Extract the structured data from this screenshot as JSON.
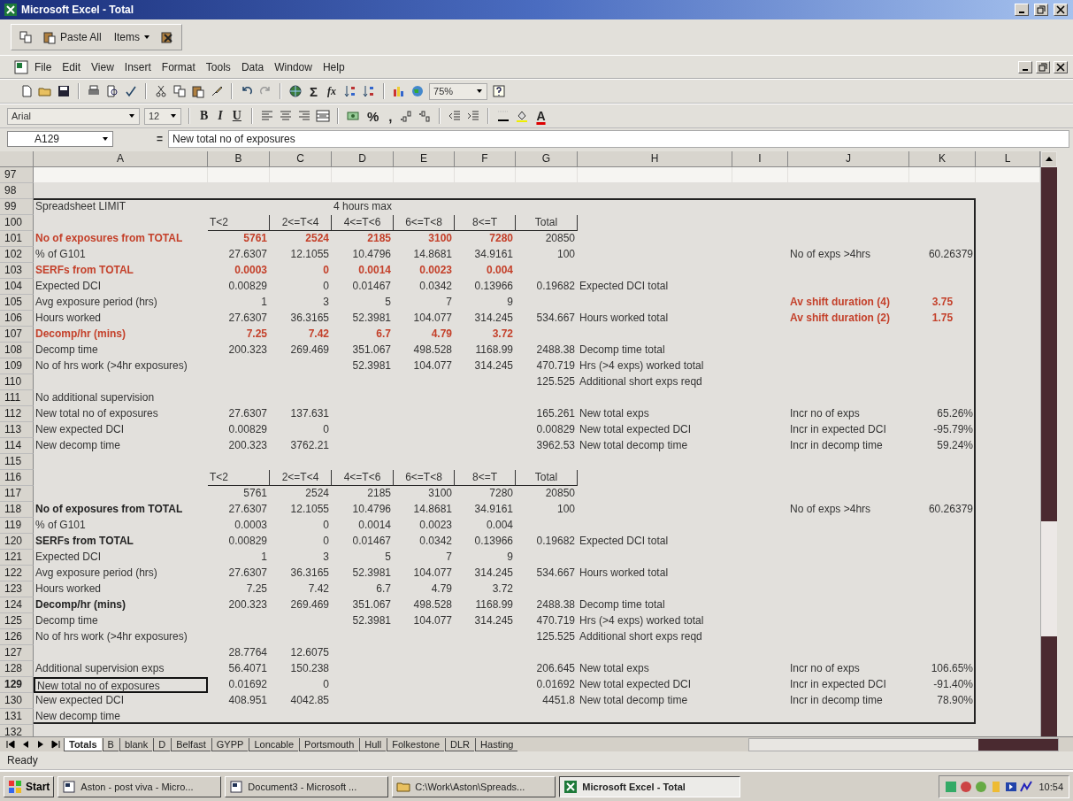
{
  "window": {
    "title": "Microsoft Excel - Total"
  },
  "clipboard_toolbar": {
    "paste_all": "Paste All",
    "items": "Items"
  },
  "menu": [
    "File",
    "Edit",
    "View",
    "Insert",
    "Format",
    "Tools",
    "Data",
    "Window",
    "Help"
  ],
  "standard_toolbar": {
    "sum": "Σ",
    "function": "fx",
    "zoom": "75%"
  },
  "formatting_toolbar": {
    "font": "Arial",
    "size": "12",
    "bold": "B",
    "italic": "I",
    "underline": "U",
    "percent": "%",
    "comma": ",",
    "font_color": "A"
  },
  "formula_bar": {
    "name_box": "A129",
    "equals": "=",
    "content": "New total no of exposures"
  },
  "columns": [
    "A",
    "B",
    "C",
    "D",
    "E",
    "F",
    "G",
    "H",
    "I",
    "J",
    "K",
    "L"
  ],
  "rows": [
    {
      "num": "97",
      "selected": false,
      "cells": {}
    },
    {
      "num": "98",
      "selected": false,
      "cells": {}
    },
    {
      "num": "99",
      "kind": "caption",
      "selected": false,
      "cells": {
        "A": "Spreadsheet LIMIT",
        "D": "4 hours max"
      }
    },
    {
      "num": "100",
      "kind": "header",
      "selected": false,
      "cells": {
        "B": "T<2",
        "C": "2<=T<4",
        "D": "4<=T<6",
        "E": "6<=T<8",
        "F": "8<=T",
        "G": "Total"
      }
    },
    {
      "num": "101",
      "kind": "highlighted",
      "selected": false,
      "cells": {
        "A": "No of exposures from TOTAL",
        "B": "5761",
        "C": "2524",
        "D": "2185",
        "E": "3100",
        "F": "7280",
        "G": "20850"
      }
    },
    {
      "num": "102",
      "kind": "plain",
      "selected": false,
      "cells": {
        "A": "% of G101",
        "B": "27.6307",
        "C": "12.1055",
        "D": "10.4796",
        "E": "14.8681",
        "F": "34.9161",
        "G": "100",
        "J": "No of exps >4hrs",
        "K": "60.26379"
      }
    },
    {
      "num": "103",
      "kind": "highlighted",
      "selected": false,
      "cells": {
        "A": "SERFs from TOTAL",
        "B": "0.0003",
        "C": "0",
        "D": "0.0014",
        "E": "0.0023",
        "F": "0.004"
      }
    },
    {
      "num": "104",
      "kind": "plain",
      "selected": false,
      "cells": {
        "A": "Expected DCI",
        "B": "0.00829",
        "C": "0",
        "D": "0.01467",
        "E": "0.0342",
        "F": "0.13966",
        "G": "0.19682",
        "H": "Expected DCI total"
      }
    },
    {
      "num": "105",
      "kind": "shift",
      "selected": false,
      "cells": {
        "A": "Avg exposure period (hrs)",
        "B": "1",
        "C": "3",
        "D": "5",
        "E": "7",
        "F": "9",
        "J": "Av shift duration (4)",
        "K": "3.75"
      }
    },
    {
      "num": "106",
      "kind": "shift",
      "selected": false,
      "cells": {
        "A": "Hours worked",
        "B": "27.6307",
        "C": "36.3165",
        "D": "52.3981",
        "E": "104.077",
        "F": "314.245",
        "G": "534.667",
        "H": "Hours worked total",
        "J": "Av shift duration (2)",
        "K": "1.75"
      }
    },
    {
      "num": "107",
      "kind": "highlighted",
      "selected": false,
      "cells": {
        "A": "Decomp/hr (mins)",
        "B": "7.25",
        "C": "7.42",
        "D": "6.7",
        "E": "4.79",
        "F": "3.72"
      }
    },
    {
      "num": "108",
      "kind": "plain",
      "selected": false,
      "cells": {
        "A": "Decomp time",
        "B": "200.323",
        "C": "269.469",
        "D": "351.067",
        "E": "498.528",
        "F": "1168.99",
        "G": "2488.38",
        "H": "Decomp time total"
      }
    },
    {
      "num": "109",
      "kind": "plain",
      "selected": false,
      "cells": {
        "A": "No of hrs work (>4hr exposures)",
        "D": "52.3981",
        "E": "104.077",
        "F": "314.245",
        "G": "470.719",
        "H": "Hrs (>4 exps) worked total"
      }
    },
    {
      "num": "110",
      "kind": "plain",
      "selected": false,
      "cells": {
        "G": "125.525",
        "H": "Additional short exps reqd"
      }
    },
    {
      "num": "111",
      "kind": "plain",
      "selected": false,
      "cells": {
        "A": "No additional supervision"
      }
    },
    {
      "num": "112",
      "kind": "plain",
      "selected": false,
      "cells": {
        "A": "New total no of exposures",
        "B": "27.6307",
        "C": "137.631",
        "G": "165.261",
        "H": "New total exps",
        "J": "Incr no of exps",
        "K": "65.26%"
      }
    },
    {
      "num": "113",
      "kind": "plain",
      "selected": false,
      "cells": {
        "A": "New expected DCI",
        "B": "0.00829",
        "C": "0",
        "G": "0.00829",
        "H": "New total expected DCI",
        "J": "Incr in expected DCI",
        "K": "-95.79%"
      }
    },
    {
      "num": "114",
      "kind": "plain",
      "selected": false,
      "cells": {
        "A": "New decomp time",
        "B": "200.323",
        "C": "3762.21",
        "G": "3962.53",
        "H": "New total decomp time",
        "J": "Incr in decomp time",
        "K": "59.24%"
      }
    },
    {
      "num": "115",
      "selected": false,
      "cells": {}
    },
    {
      "num": "116",
      "kind": "header",
      "selected": false,
      "cells": {
        "B": "T<2",
        "C": "2<=T<4",
        "D": "4<=T<6",
        "E": "6<=T<8",
        "F": "8<=T",
        "G": "Total"
      }
    },
    {
      "num": "117",
      "kind": "plain",
      "selected": false,
      "cells": {
        "B": "5761",
        "C": "2524",
        "D": "2185",
        "E": "3100",
        "F": "7280",
        "G": "20850"
      }
    },
    {
      "num": "118",
      "kind": "bold",
      "selected": false,
      "cells": {
        "A": "No of exposures from TOTAL",
        "B": "27.6307",
        "C": "12.1055",
        "D": "10.4796",
        "E": "14.8681",
        "F": "34.9161",
        "G": "100",
        "J": "No of exps >4hrs",
        "K": "60.26379"
      }
    },
    {
      "num": "119",
      "kind": "plain",
      "selected": false,
      "cells": {
        "A": "% of G101",
        "B": "0.0003",
        "C": "0",
        "D": "0.0014",
        "E": "0.0023",
        "F": "0.004"
      }
    },
    {
      "num": "120",
      "kind": "bold",
      "selected": false,
      "cells": {
        "A": "SERFs from TOTAL",
        "B": "0.00829",
        "C": "0",
        "D": "0.01467",
        "E": "0.0342",
        "F": "0.13966",
        "G": "0.19682",
        "H": "Expected DCI total"
      }
    },
    {
      "num": "121",
      "kind": "plain",
      "selected": false,
      "cells": {
        "A": "Expected DCI",
        "B": "1",
        "C": "3",
        "D": "5",
        "E": "7",
        "F": "9"
      }
    },
    {
      "num": "122",
      "kind": "plain",
      "selected": false,
      "cells": {
        "A": "Avg exposure period (hrs)",
        "B": "27.6307",
        "C": "36.3165",
        "D": "52.3981",
        "E": "104.077",
        "F": "314.245",
        "G": "534.667",
        "H": "Hours worked total"
      }
    },
    {
      "num": "123",
      "kind": "plain",
      "selected": false,
      "cells": {
        "A": "Hours worked",
        "B": "7.25",
        "C": "7.42",
        "D": "6.7",
        "E": "4.79",
        "F": "3.72"
      }
    },
    {
      "num": "124",
      "kind": "bold",
      "selected": false,
      "cells": {
        "A": "Decomp/hr (mins)",
        "B": "200.323",
        "C": "269.469",
        "D": "351.067",
        "E": "498.528",
        "F": "1168.99",
        "G": "2488.38",
        "H": "Decomp time total"
      }
    },
    {
      "num": "125",
      "kind": "plain",
      "selected": false,
      "cells": {
        "A": "Decomp time",
        "D": "52.3981",
        "E": "104.077",
        "F": "314.245",
        "G": "470.719",
        "H": "Hrs (>4 exps) worked total"
      }
    },
    {
      "num": "126",
      "kind": "plain",
      "selected": false,
      "cells": {
        "A": "No of hrs work (>4hr exposures)",
        "G": "125.525",
        "H": "Additional short exps reqd"
      }
    },
    {
      "num": "127",
      "kind": "plain",
      "selected": false,
      "cells": {
        "B": "28.7764",
        "C": "12.6075"
      }
    },
    {
      "num": "128",
      "kind": "plain",
      "selected": false,
      "cells": {
        "A": "Additional supervision exps",
        "B": "56.4071",
        "C": "150.238",
        "G": "206.645",
        "H": "New total exps",
        "J": "Incr no of exps",
        "K": "106.65%"
      }
    },
    {
      "num": "129",
      "kind": "plain",
      "selected": true,
      "cells": {
        "A": "New total no of exposures",
        "B": "0.01692",
        "C": "0",
        "G": "0.01692",
        "H": "New total expected DCI",
        "J": "Incr in expected DCI",
        "K": "-91.40%"
      }
    },
    {
      "num": "130",
      "kind": "plain",
      "selected": false,
      "cells": {
        "A": "New expected DCI",
        "B": "408.951",
        "C": "4042.85",
        "G": "4451.8",
        "H": "New total decomp time",
        "J": "Incr in decomp time",
        "K": "78.90%"
      }
    },
    {
      "num": "131",
      "kind": "plain",
      "selected": false,
      "cells": {
        "A": "New decomp time"
      }
    },
    {
      "num": "132",
      "selected": false,
      "cells": {}
    }
  ],
  "sheet_tabs": [
    {
      "label": "Totals",
      "selected": true
    },
    {
      "label": "B",
      "selected": false
    },
    {
      "label": "blank",
      "selected": false
    },
    {
      "label": "D",
      "selected": false
    },
    {
      "label": "Belfast",
      "selected": false
    },
    {
      "label": "GYPP",
      "selected": false
    },
    {
      "label": "Loncable",
      "selected": false
    },
    {
      "label": "Portsmouth",
      "selected": false
    },
    {
      "label": "Hull",
      "selected": false
    },
    {
      "label": "Folkestone",
      "selected": false
    },
    {
      "label": "DLR",
      "selected": false
    },
    {
      "label": "Hasting",
      "selected": false
    }
  ],
  "status_bar": {
    "text": "Ready"
  },
  "taskbar": {
    "start": "Start",
    "buttons": [
      {
        "label": "Aston - post viva - Micro...",
        "kind": "document",
        "selected": false
      },
      {
        "label": "Document3 - Microsoft ...",
        "kind": "document",
        "selected": false
      },
      {
        "label": "C:\\Work\\Aston\\Spreads...",
        "kind": "folder",
        "selected": false
      },
      {
        "label": "Microsoft Excel - Total",
        "kind": "excel",
        "selected": true
      }
    ],
    "clock": "10:54"
  }
}
